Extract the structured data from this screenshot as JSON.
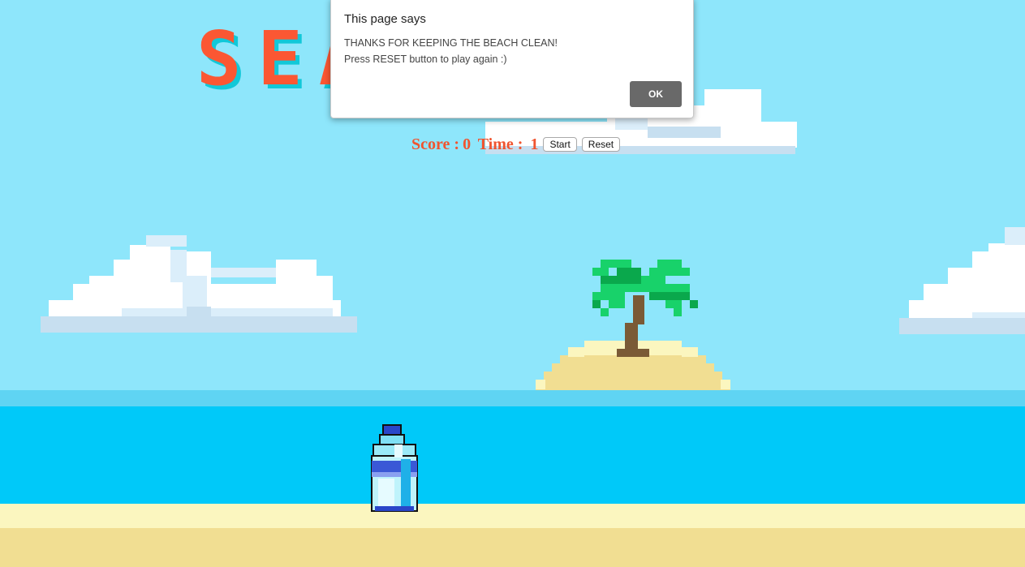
{
  "game": {
    "title": "SEA BOT",
    "score_label": "Score : ",
    "score": "0",
    "time_label": " Time : ",
    "time": "1",
    "start_label": "Start",
    "reset_label": "Reset"
  },
  "dialog": {
    "title": "This page says",
    "message_line1": "THANKS FOR KEEPING THE BEACH CLEAN!",
    "message_line2": "Press RESET button to play again :)",
    "ok_label": "OK"
  },
  "scene": {
    "sprites": [
      "cloud-sprite",
      "palm-island-sprite",
      "water-bottle-sprite"
    ]
  },
  "colors": {
    "sky": "#8ee6fb",
    "sea": "#00c9f9",
    "sand": "#f1de92",
    "title": "#fb5733",
    "title_shadow": "#11c8d8",
    "hud": "#f0542f"
  }
}
